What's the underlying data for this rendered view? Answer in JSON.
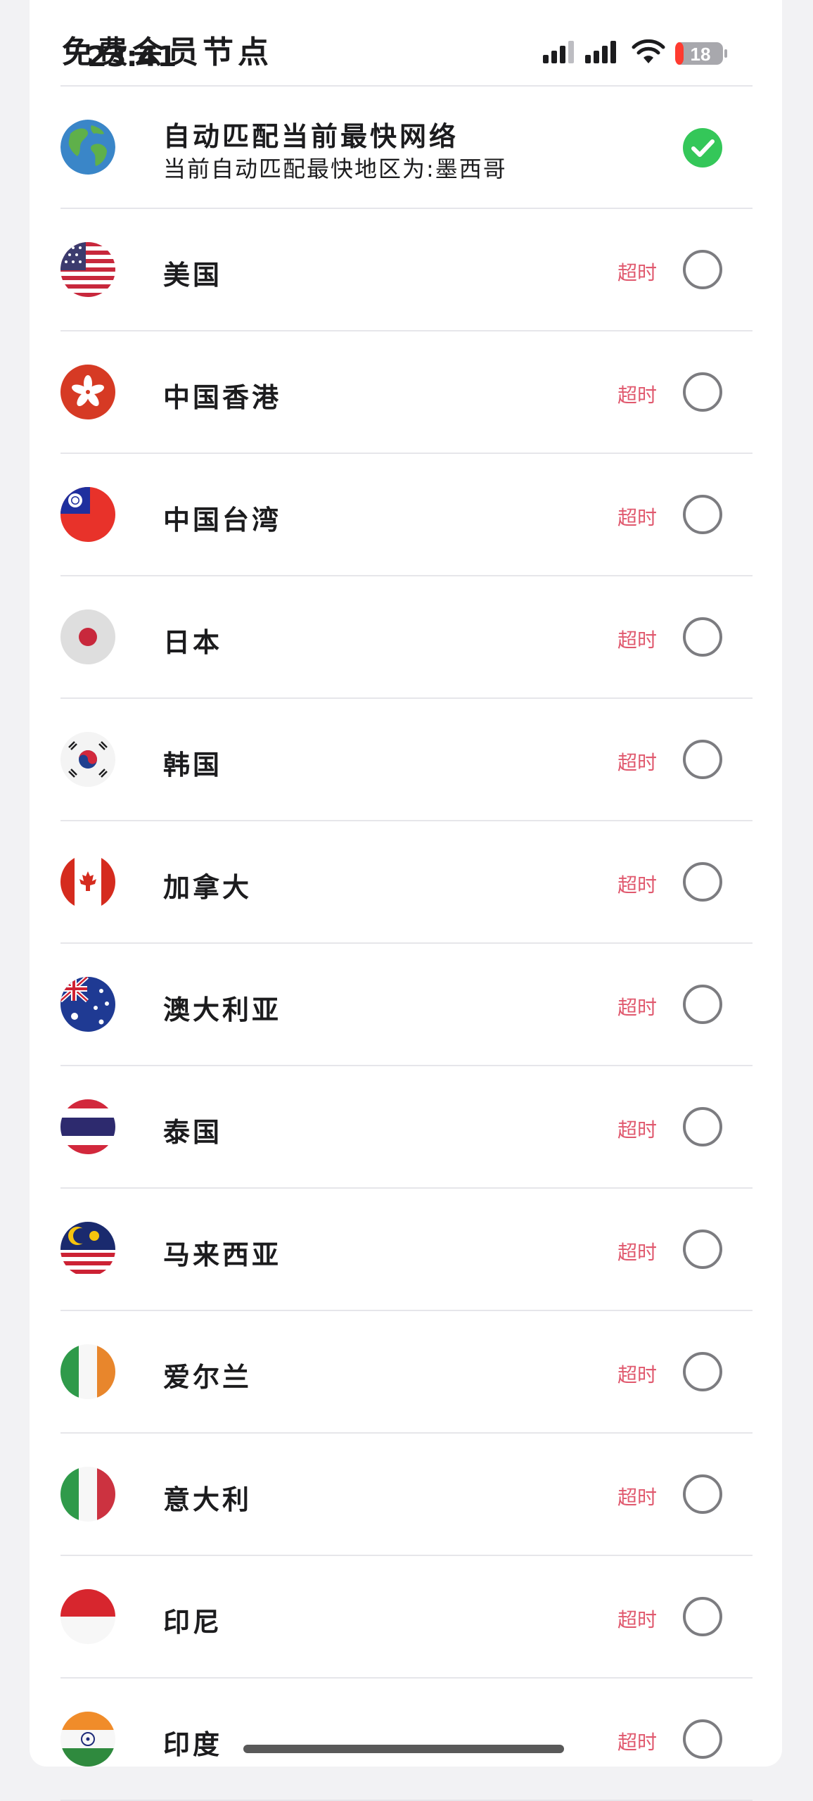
{
  "status_bar": {
    "time": "23:41",
    "battery_level": "18",
    "battery_color": "#ff3b30",
    "icons": [
      "signal-icon",
      "signal-icon",
      "wifi-icon",
      "battery-icon"
    ]
  },
  "header": {
    "title": "免费会员节点"
  },
  "auto": {
    "title": "自动匹配当前最快网络",
    "subtitle": "当前自动匹配最快地区为:墨西哥",
    "selected": true,
    "icon": "globe-icon",
    "check_color": "#34c759"
  },
  "nodes": [
    {
      "name": "美国",
      "status": "超时",
      "flag": "us-flag-icon"
    },
    {
      "name": "中国香港",
      "status": "超时",
      "flag": "hk-flag-icon"
    },
    {
      "name": "中国台湾",
      "status": "超时",
      "flag": "tw-flag-icon"
    },
    {
      "name": "日本",
      "status": "超时",
      "flag": "jp-flag-icon"
    },
    {
      "name": "韩国",
      "status": "超时",
      "flag": "kr-flag-icon"
    },
    {
      "name": "加拿大",
      "status": "超时",
      "flag": "ca-flag-icon"
    },
    {
      "name": "澳大利亚",
      "status": "超时",
      "flag": "au-flag-icon"
    },
    {
      "name": "泰国",
      "status": "超时",
      "flag": "th-flag-icon"
    },
    {
      "name": "马来西亚",
      "status": "超时",
      "flag": "my-flag-icon"
    },
    {
      "name": "爱尔兰",
      "status": "超时",
      "flag": "ie-flag-icon"
    },
    {
      "name": "意大利",
      "status": "超时",
      "flag": "it-flag-icon"
    },
    {
      "name": "印尼",
      "status": "超时",
      "flag": "id-flag-icon"
    },
    {
      "name": "印度",
      "status": "超时",
      "flag": "in-flag-icon"
    }
  ],
  "colors": {
    "timeout_text": "#e0596e",
    "radio_border": "#7c7c80",
    "separator": "#e6e6ea"
  }
}
